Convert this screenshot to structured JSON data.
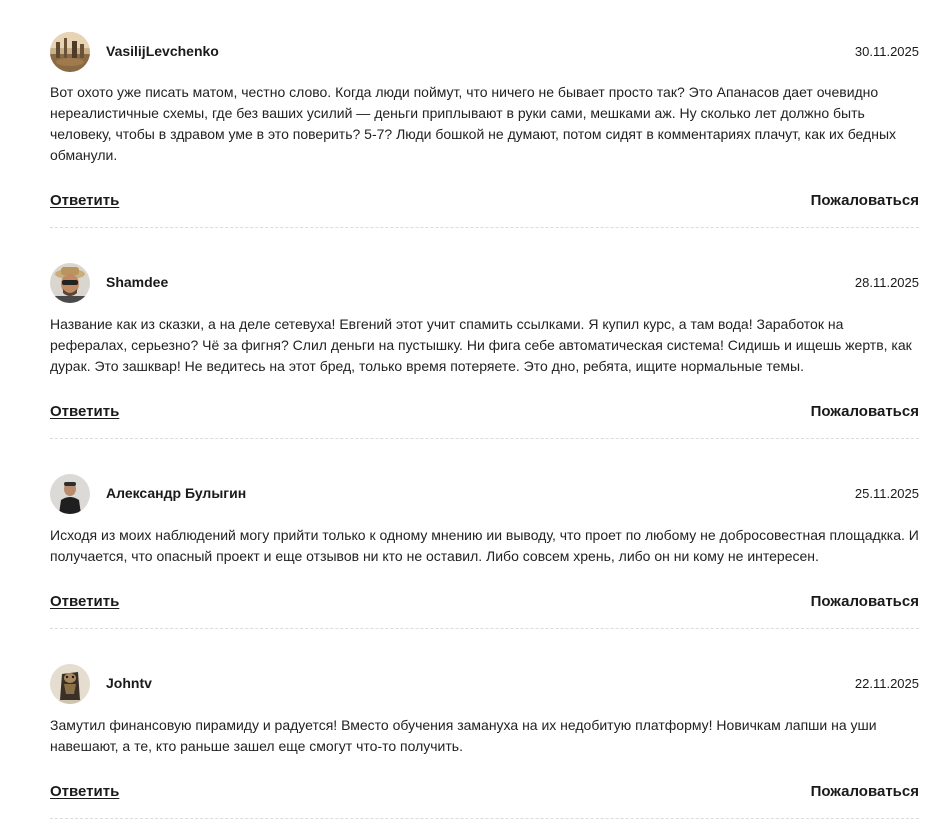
{
  "actions": {
    "reply_label": "Ответить",
    "report_label": "Пожаловаться"
  },
  "comments": [
    {
      "author": "VasilijLevchenko",
      "date": "30.11.2025",
      "avatar_icon": "photo-avatar-landscape",
      "text": "Вот охото уже писать матом, честно слово. Когда люди поймут, что ничего не бывает просто так? Это Апанасов дает очевидно нереалистичные схемы, где без ваших усилий — деньги приплывают в руки сами, мешками аж. Ну сколько лет должно быть человеку, чтобы в здравом уме в это поверить? 5-7? Люди бошкой не думают, потом сидят в комментариях плачут, как их бедных обманули."
    },
    {
      "author": "Shamdee",
      "date": "28.11.2025",
      "avatar_icon": "photo-avatar-man-hat-sunglasses",
      "text": "Название как из сказки, а на деле сетевуха! Евгений этот учит спамить ссылками. Я купил курс, а там вода! Заработок на рефералах, серьезно? Чё за фигня? Слил деньги на пустышку. Ни фига себе автоматическая система! Сидишь и ищешь жертв, как дурак. Это зашквар! Не ведитесь на этот бред, только время потеряете. Это дно, ребята, ищите нормальные темы."
    },
    {
      "author": "Александр Булыгин",
      "date": "25.11.2025",
      "avatar_icon": "photo-avatar-man-dark-shirt",
      "text": "Исходя из моих наблюдений могу прийти только к одному мнению ии выводу, что проет по любому не добросовестная площадкка. И получается, что опасный проект и еще отзывов ни кто не оставил. Либо совсем хрень, либо он ни кому не интересен."
    },
    {
      "author": "Johntv",
      "date": "22.11.2025",
      "avatar_icon": "photo-avatar-figure",
      "text": "Замутил финансовую пирамиду и радуется! Вместо обучения замануха на их недобитую платформу! Новичкам лапши на уши навешают, а те, кто раньше зашел еще смогут что-то получить."
    }
  ]
}
